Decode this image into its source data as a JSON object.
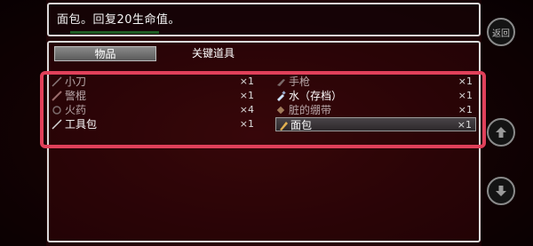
{
  "message": {
    "text": "面包。回复20生命值。"
  },
  "tabs": [
    {
      "label": "物品",
      "active": true
    },
    {
      "label": "关键道具",
      "active": false
    }
  ],
  "items_left": [
    {
      "name": "小刀",
      "count": "×1",
      "icon": "knife-icon"
    },
    {
      "name": "警棍",
      "count": "×1",
      "icon": "baton-icon"
    },
    {
      "name": "火药",
      "count": "×4",
      "icon": "gunpowder-icon"
    },
    {
      "name": "工具包",
      "count": "×1",
      "icon": "toolkit-icon"
    }
  ],
  "items_right": [
    {
      "name": "手枪",
      "count": "×1",
      "icon": "pistol-icon"
    },
    {
      "name": "水（存档）",
      "count": "×1",
      "icon": "water-bottle-icon"
    },
    {
      "name": "脏的绷带",
      "count": "×1",
      "icon": "bandage-icon"
    },
    {
      "name": "面包",
      "count": "×1",
      "icon": "bread-icon",
      "selected": true
    }
  ],
  "buttons": {
    "back": "返回"
  },
  "colors": {
    "highlight": "#e0405a",
    "selection": "#3a3538",
    "background": "#2a0508"
  }
}
